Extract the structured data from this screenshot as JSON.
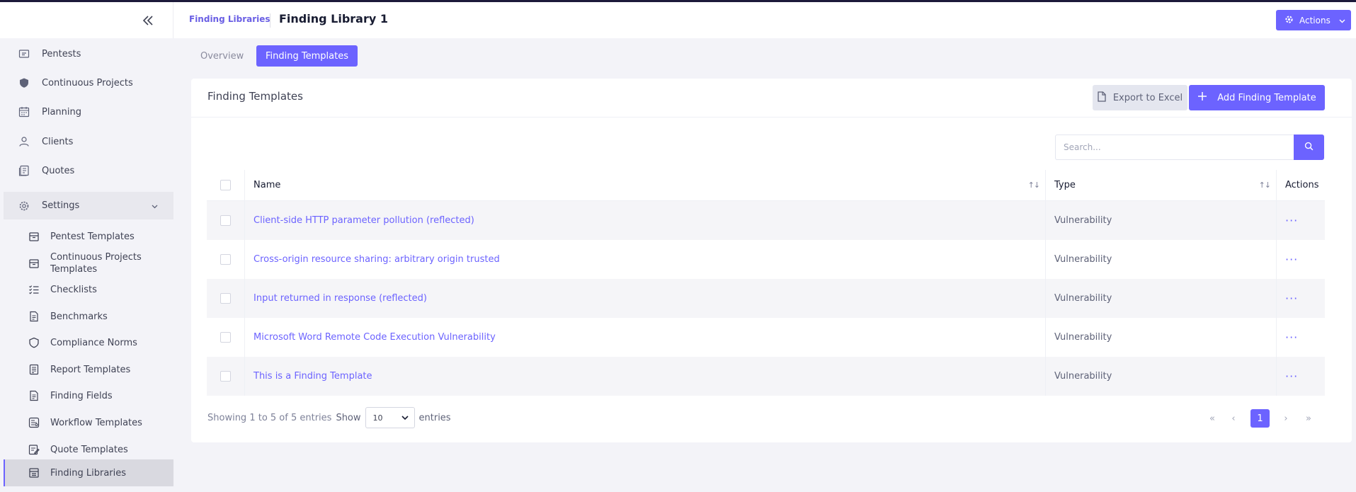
{
  "header": {
    "breadcrumb": "Finding Libraries",
    "title": "Finding Library 1",
    "actions_label": "Actions"
  },
  "sidebar": {
    "items": [
      {
        "label": "Pentests",
        "icon": "briefcase-icon"
      },
      {
        "label": "Continuous Projects",
        "icon": "shield-icon"
      },
      {
        "label": "Planning",
        "icon": "calendar-icon"
      },
      {
        "label": "Clients",
        "icon": "user-icon"
      },
      {
        "label": "Quotes",
        "icon": "quote-icon"
      },
      {
        "label": "Settings",
        "icon": "gear-icon"
      }
    ],
    "settings_items": [
      {
        "label": "Pentest Templates"
      },
      {
        "label": "Continuous Projects Templates"
      },
      {
        "label": "Checklists"
      },
      {
        "label": "Benchmarks"
      },
      {
        "label": "Compliance Norms"
      },
      {
        "label": "Report Templates"
      },
      {
        "label": "Finding Fields"
      },
      {
        "label": "Workflow Templates"
      },
      {
        "label": "Quote Templates"
      },
      {
        "label": "Finding Libraries"
      }
    ]
  },
  "tabs": {
    "overview": "Overview",
    "finding_templates": "Finding Templates"
  },
  "card": {
    "title": "Finding Templates",
    "export_label": "Export to Excel",
    "add_label": "Add Finding Template",
    "search_placeholder": "Search..."
  },
  "table": {
    "columns": {
      "name": "Name",
      "type": "Type",
      "actions": "Actions"
    },
    "rows": [
      {
        "name": "Client-side HTTP parameter pollution (reflected)",
        "type": "Vulnerability"
      },
      {
        "name": "Cross-origin resource sharing: arbitrary origin trusted",
        "type": "Vulnerability"
      },
      {
        "name": "Input returned in response (reflected)",
        "type": "Vulnerability"
      },
      {
        "name": "Microsoft Word Remote Code Execution Vulnerability",
        "type": "Vulnerability"
      },
      {
        "name": "This is a Finding Template",
        "type": "Vulnerability"
      }
    ]
  },
  "footer": {
    "showing": "Showing 1 to 5 of 5 entries",
    "show": "Show",
    "page_size": "10",
    "entries": "entries",
    "current_page": "1"
  },
  "colors": {
    "accent": "#6c63ff",
    "sidebar_bg": "#f3f3f8"
  }
}
